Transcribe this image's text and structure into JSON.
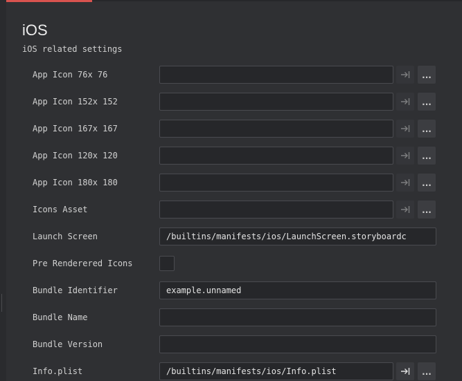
{
  "section": {
    "title": "iOS",
    "subtitle": "iOS related settings"
  },
  "fields": [
    {
      "label": "App Icon 76x 76",
      "value": "",
      "has_buttons": true
    },
    {
      "label": "App Icon 152x 152",
      "value": "",
      "has_buttons": true
    },
    {
      "label": "App Icon 167x 167",
      "value": "",
      "has_buttons": true
    },
    {
      "label": "App Icon 120x 120",
      "value": "",
      "has_buttons": true
    },
    {
      "label": "App Icon 180x 180",
      "value": "",
      "has_buttons": true
    },
    {
      "label": "Icons Asset",
      "value": "",
      "has_buttons": true
    },
    {
      "label": "Launch Screen",
      "value": "/builtins/manifests/ios/LaunchScreen.storyboardc",
      "has_buttons": false
    },
    {
      "label": "Pre Renderered Icons",
      "type": "checkbox",
      "checked": false
    },
    {
      "label": "Bundle Identifier",
      "value": "example.unnamed",
      "has_buttons": false
    },
    {
      "label": "Bundle Name",
      "value": "",
      "has_buttons": false
    },
    {
      "label": "Bundle Version",
      "value": "",
      "has_buttons": false
    },
    {
      "label": "Info.plist",
      "value": "/builtins/manifests/ios/Info.plist",
      "has_buttons": true
    }
  ],
  "buttons": {
    "browse_label": "...",
    "assign_icon": "arrow-to-line-icon"
  },
  "colors": {
    "accent": "#d9534f",
    "background": "#2f3033",
    "field_background": "#26272a",
    "field_border": "#4a4b50"
  }
}
